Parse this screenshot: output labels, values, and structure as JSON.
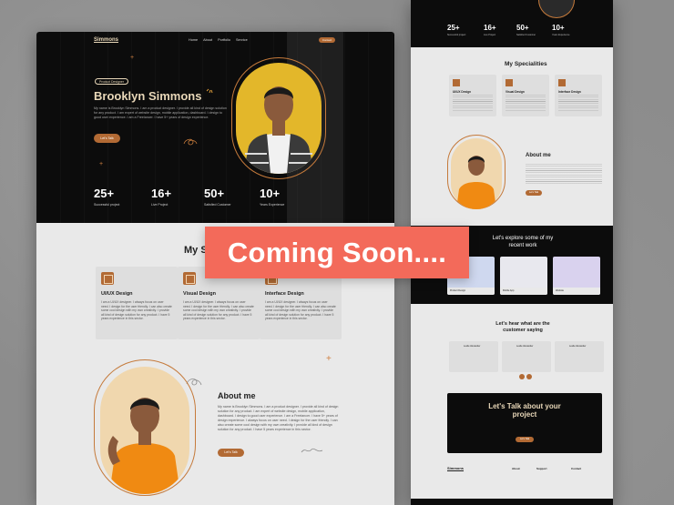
{
  "colors": {
    "accent": "#b26a34",
    "banner": "#f36a5a",
    "hero_bg": "#0c0c0c",
    "name": "#e8d7b8"
  },
  "banner": {
    "text": "Coming Soon...."
  },
  "left": {
    "logo": "Simmons",
    "nav": [
      "Home",
      "About",
      "Portfolio",
      "Service"
    ],
    "contact": "Contact",
    "tag": "Product Designer",
    "name": "Brooklyn Simmons",
    "intro": "My name is Brooklyn Simmons. I am a product designer. I provide all kind of design solution for any product. I am expert of website design, mobile application, dashboard. I design to good user experience. I am a Freelancer. I have 5+ years of design experience.",
    "cta": "Let's Talk",
    "stats": [
      {
        "num": "25+",
        "label": "Successful project"
      },
      {
        "num": "16+",
        "label": "Live Project"
      },
      {
        "num": "50+",
        "label": "Satisfied Customer"
      },
      {
        "num": "10+",
        "label": "Years Experience"
      }
    ],
    "specialities_title": "My Specialities",
    "cards": [
      {
        "title": "UI/UX Design",
        "desc": "I am a UI/UX designer. I always focus on user need. I design for the user friendly. I can also create some cool design with my own creativity. I provide all kind of design solution for any product. I have 5 years experience in this sector."
      },
      {
        "title": "Visual Design",
        "desc": "I am a UI/UX designer. I always focus on user need. I design for the user friendly. I can also create some cool design with my own creativity. I provide all kind of design solution for any product. I have 5 years experience in this sector."
      },
      {
        "title": "Interface Design",
        "desc": "I am a UI/UX designer. I always focus on user need. I design for the user friendly. I can also create some cool design with my own creativity. I provide all kind of design solution for any product. I have 5 years experience in this sector."
      }
    ],
    "about_title": "About me",
    "about_text": "My name is Brooklyn Simmons. I am a product designer. I provide all kind of design solution for any product. I am expert of website design, mobile application, dashboard. I design to good user experience. I am a Freelancer. I have 5+ years of design experience. I always focus on user need. I design for the user friendly. I can also create some cool design with my own creativity. I provide all kind of design solution for any product. I have 5 years experience in this sector.",
    "about_cta": "Let's Talk"
  },
  "right": {
    "stats": [
      {
        "num": "25+",
        "label": "Successful project"
      },
      {
        "num": "16+",
        "label": "Live Project"
      },
      {
        "num": "50+",
        "label": "Satisfied Customer"
      },
      {
        "num": "10+",
        "label": "Years Experience"
      }
    ],
    "specialities_title": "My Specialities",
    "cards": [
      "UI/UX Design",
      "Visual Design",
      "Interface Design"
    ],
    "about_title": "About me",
    "about_cta": "Let's Talk",
    "work_title": "Let's explore some of my recent work",
    "work_items": [
      "Product Design",
      "Mobile App",
      "Website"
    ],
    "testimonial_title": "Let's hear what are the customer saying",
    "testimonials": [
      "Leslie Alexander",
      "Leslie Alexander",
      "Leslie Alexander"
    ],
    "cta_title": "Let's Talk about your project",
    "cta_btn": "Let's Talk",
    "footer_logo": "Simmons",
    "footer_cols": [
      "About",
      "Support",
      "Contact"
    ]
  }
}
